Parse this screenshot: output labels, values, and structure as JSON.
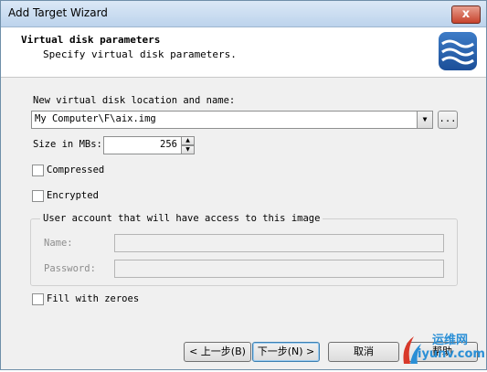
{
  "window": {
    "title": "Add Target Wizard",
    "close_glyph": "x"
  },
  "header": {
    "title": "Virtual disk parameters",
    "subtitle": "Specify virtual disk parameters."
  },
  "location": {
    "label": "New virtual disk location and name:",
    "value": "My Computer\\F\\aix.img",
    "browse_label": "..."
  },
  "size": {
    "label": "Size in MBs:",
    "value": "256"
  },
  "options": {
    "compressed": "Compressed",
    "encrypted": "Encrypted",
    "fill_zeroes": "Fill with zeroes"
  },
  "user_account": {
    "legend": "User account that will have access to this image",
    "name_label": "Name:",
    "password_label": "Password:"
  },
  "buttons": {
    "back": "< 上一步(B)",
    "next": "下一步(N) >",
    "cancel": "取消",
    "help": "帮助"
  },
  "watermark": {
    "line1": "运维网",
    "line2": "iyunv.com"
  },
  "icons": {
    "logo": "waves-logo-icon",
    "dropdown": "chevron-down-icon"
  },
  "colors": {
    "title_bar": "#bcd3ec",
    "close": "#c7432d",
    "logo": "#1c4f98"
  }
}
